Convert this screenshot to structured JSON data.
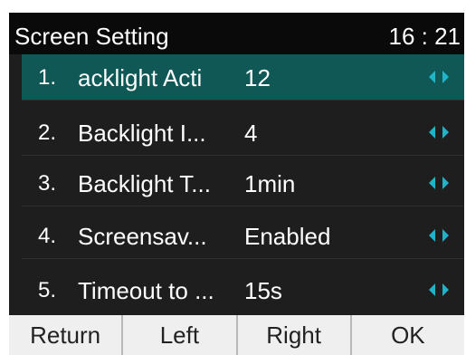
{
  "header": {
    "title": "Screen Setting",
    "time": "16 : 21"
  },
  "list": [
    {
      "num": "1.",
      "name": "acklight Acti",
      "value": "12",
      "selected": true
    },
    {
      "num": "2.",
      "name": "Backlight I...",
      "value": "4",
      "selected": false
    },
    {
      "num": "3.",
      "name": "Backlight T...",
      "value": "1min",
      "selected": false
    },
    {
      "num": "4.",
      "name": "Screensav...",
      "value": "Enabled",
      "selected": false
    },
    {
      "num": "5.",
      "name": "Timeout to ...",
      "value": "15s",
      "selected": false
    }
  ],
  "softkeys": [
    {
      "label": "Return"
    },
    {
      "label": "Left"
    },
    {
      "label": "Right"
    },
    {
      "label": "OK"
    }
  ],
  "colors": {
    "selection": "#0f5856",
    "arrow": "#1fb4c8",
    "background": "#1e1e1e",
    "softkey_bar": "#efefef"
  },
  "icons": {
    "row_arrows": "left-right-arrows-icon"
  }
}
